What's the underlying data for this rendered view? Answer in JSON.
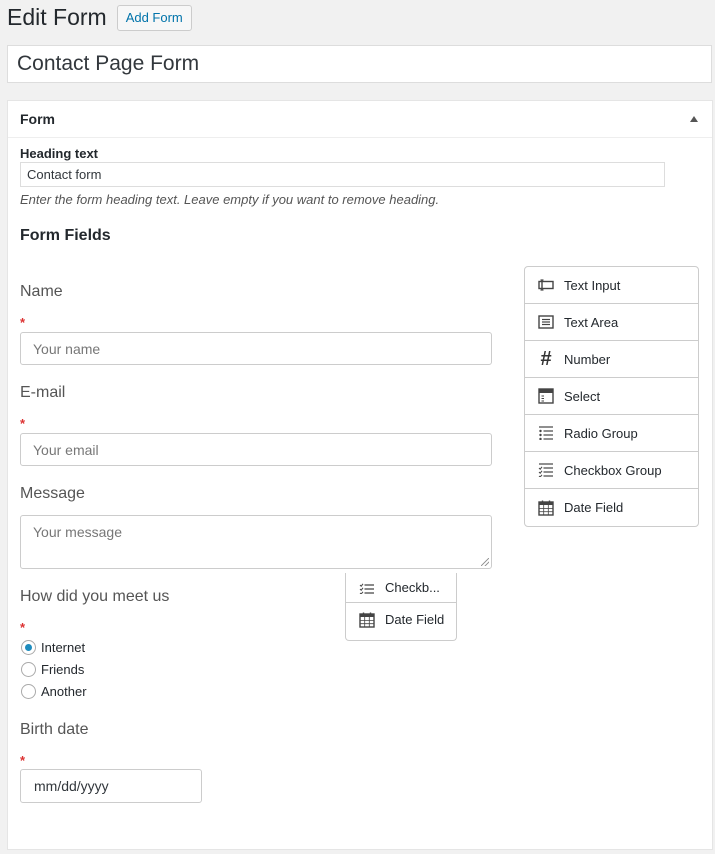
{
  "header": {
    "title": "Edit Form",
    "add_button": "Add Form"
  },
  "form_title": "Contact Page Form",
  "panel": {
    "title": "Form",
    "heading_label": "Heading text",
    "heading_value": "Contact form",
    "heading_hint": "Enter the form heading text. Leave empty if you want to remove heading.",
    "fields_title": "Form Fields"
  },
  "fields": {
    "name": {
      "label": "Name",
      "required": "*",
      "placeholder": "Your name"
    },
    "email": {
      "label": "E-mail",
      "required": "*",
      "placeholder": "Your email"
    },
    "message": {
      "label": "Message",
      "placeholder": "Your message"
    },
    "meet": {
      "label": "How did you meet us",
      "required": "*",
      "options": [
        "Internet",
        "Friends",
        "Another"
      ],
      "selected": "Internet"
    },
    "birth": {
      "label": "Birth date",
      "required": "*",
      "value": "mm/dd/yyyy"
    }
  },
  "palette": {
    "items": [
      {
        "label": "Text Input",
        "icon": "text-input-icon"
      },
      {
        "label": "Text Area",
        "icon": "text-area-icon"
      },
      {
        "label": "Number",
        "icon": "hash-icon"
      },
      {
        "label": "Select",
        "icon": "select-icon"
      },
      {
        "label": "Radio Group",
        "icon": "radio-list-icon"
      },
      {
        "label": "Checkbox Group",
        "icon": "checkbox-list-icon"
      },
      {
        "label": "Date Field",
        "icon": "calendar-icon"
      }
    ]
  },
  "drag_preview": {
    "items": [
      "Checkb...",
      "Date Field"
    ]
  }
}
